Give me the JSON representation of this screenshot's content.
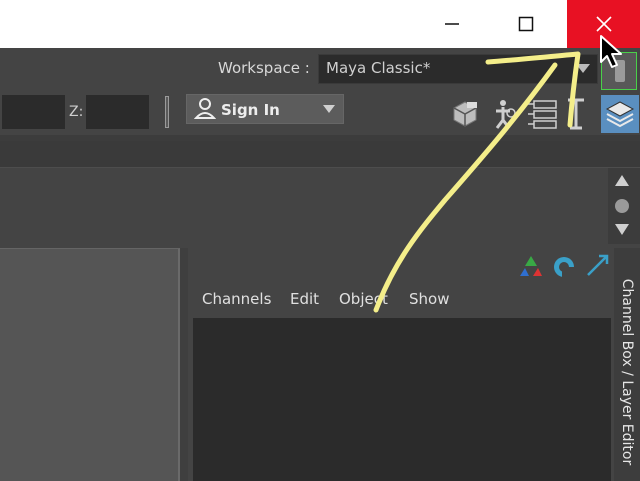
{
  "window": {
    "buttons": [
      "minimize",
      "maximize",
      "close"
    ]
  },
  "workspace": {
    "label": "Workspace :",
    "value": "Maya Classic*"
  },
  "status_line": {
    "z_label": "Z:",
    "y_value": "",
    "z_value": "",
    "sign_in_label": "Sign In"
  },
  "channel_box": {
    "menus": [
      "Channels",
      "Edit",
      "Object",
      "Show"
    ],
    "side_tab_label": "Channel Box / Layer Editor"
  },
  "colors": {
    "close_red": "#e81123",
    "annotation_yellow": "#f4ee8a",
    "toggle_green": "#49d049"
  },
  "icons": [
    "minimize-icon",
    "maximize-icon",
    "close-icon",
    "cursor-icon",
    "user-icon",
    "attribute-editor-icon",
    "tool-settings-icon",
    "channel-box-icon",
    "modeling-toolkit-icon",
    "layer-editor-icon"
  ]
}
